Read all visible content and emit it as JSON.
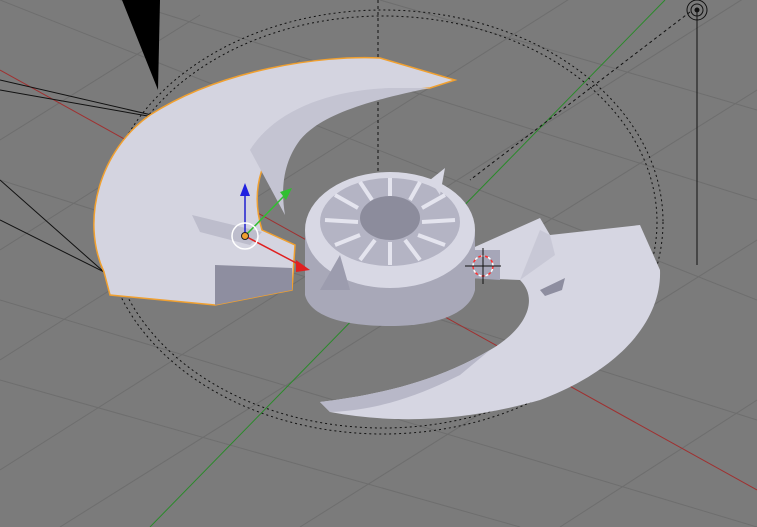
{
  "viewport": {
    "title": "",
    "background_color": "#7b7b7b",
    "grid_color": "#6f6f6f",
    "x_axis_color": "#9a3a3a",
    "y_axis_color": "#2e8b2e",
    "selection_outline_color": "#f0a030",
    "mesh_color": "#d8d8e4",
    "mesh_shadow_color": "#9a9aac"
  },
  "objects": [
    {
      "name": "fan-mesh",
      "selected": true
    },
    {
      "name": "camera",
      "selected": false
    },
    {
      "name": "lamp",
      "selected": false
    },
    {
      "name": "empty-circle-guide",
      "selected": false
    }
  ],
  "gizmo": {
    "x_axis_color": "#e02020",
    "y_axis_color": "#30c030",
    "z_axis_color": "#2020e0",
    "origin_color": "#f0a030"
  },
  "cursor": {
    "name": "3d-cursor",
    "colors": [
      "#ff3030",
      "#ffffff"
    ]
  }
}
